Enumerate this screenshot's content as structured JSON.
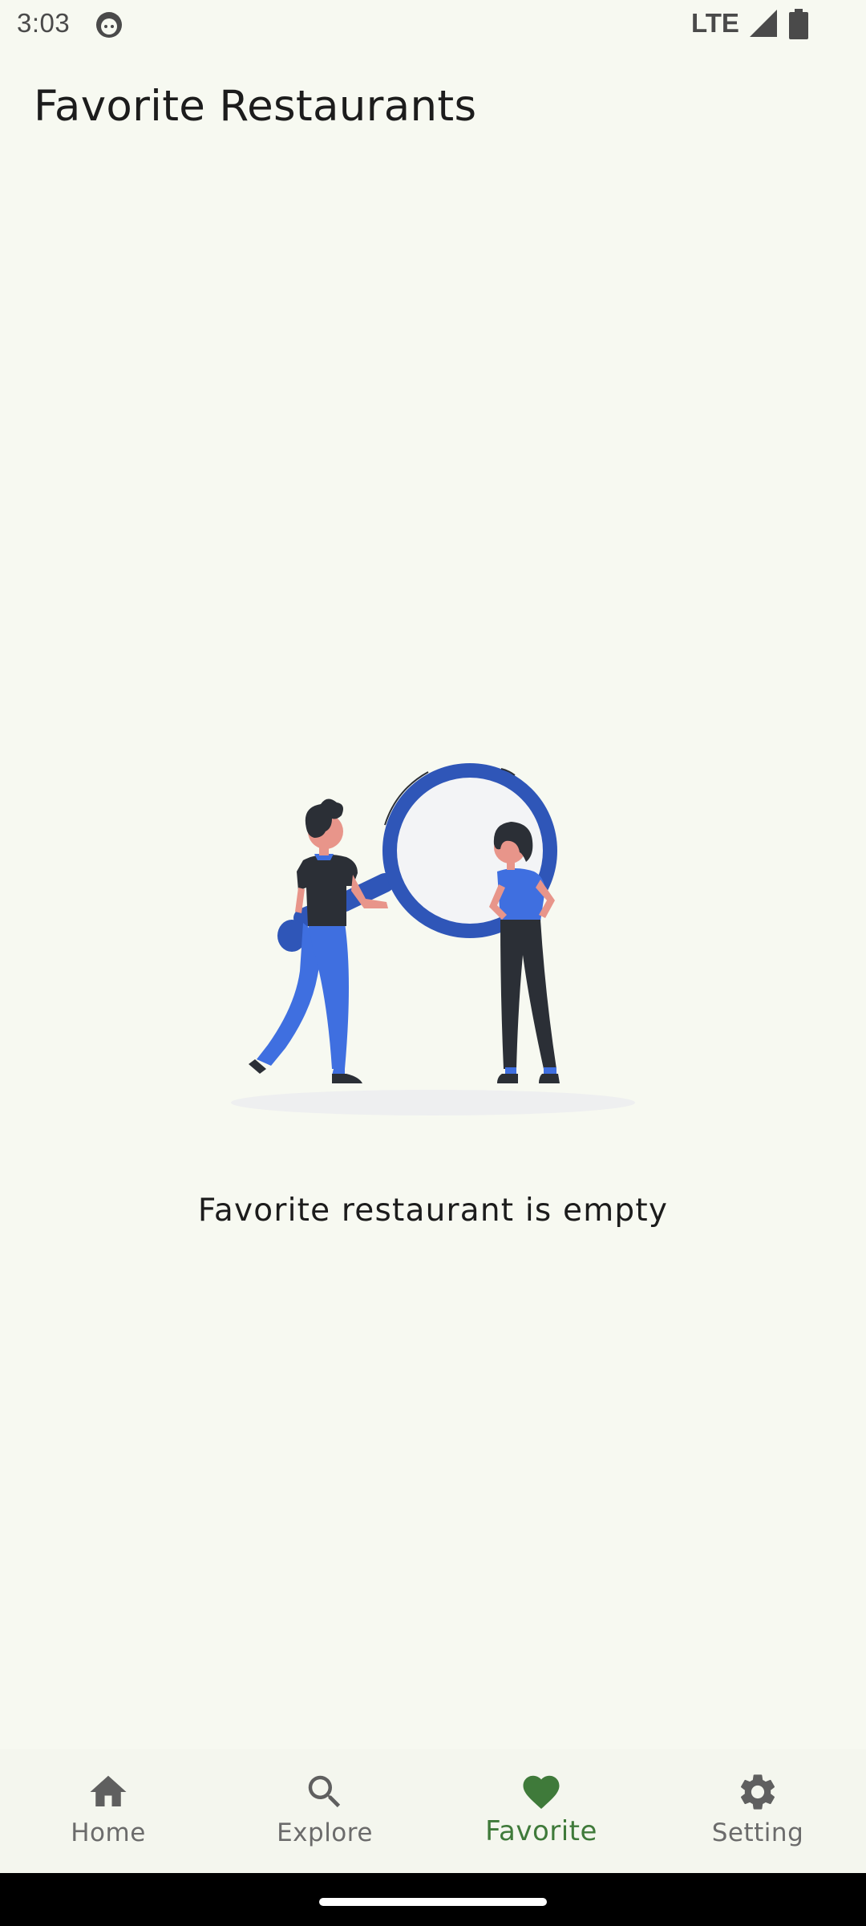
{
  "status_bar": {
    "time": "3:03",
    "network": "LTE",
    "notification_icon": "android-face-icon",
    "signal_icon": "signal-icon",
    "battery_icon": "battery-icon"
  },
  "header": {
    "title": "Favorite Restaurants"
  },
  "main": {
    "illustration": "empty-search-illustration",
    "empty_message": "Favorite restaurant is empty"
  },
  "bottom_nav": {
    "items": [
      {
        "label": "Home",
        "icon": "home-icon",
        "active": false
      },
      {
        "label": "Explore",
        "icon": "search-icon",
        "active": false
      },
      {
        "label": "Favorite",
        "icon": "heart-icon",
        "active": true
      },
      {
        "label": "Setting",
        "icon": "gear-icon",
        "active": false
      }
    ]
  },
  "colors": {
    "background": "#f7f9f1",
    "accent": "#3f7a3a",
    "inactive": "#6b6b6b",
    "illustration_blue": "#3f6fe0"
  }
}
